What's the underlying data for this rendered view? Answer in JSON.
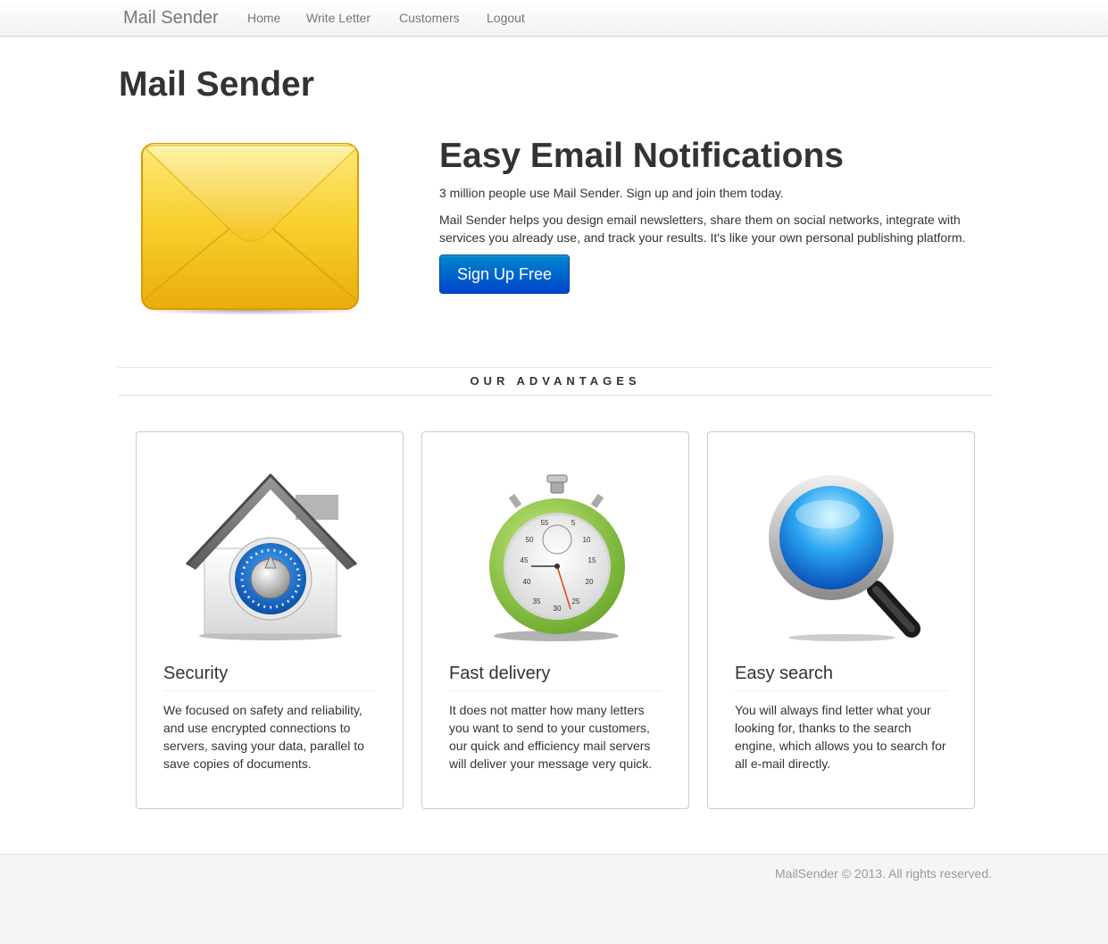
{
  "navbar": {
    "brand": "Mail Sender",
    "links": [
      {
        "label": "Home"
      },
      {
        "label": "Write Letter"
      },
      {
        "label": "Customers"
      },
      {
        "label": "Logout"
      }
    ]
  },
  "hero": {
    "page_title": "Mail Sender",
    "heading": "Easy Email Notifications",
    "lead": "3 million people use Mail Sender. Sign up and join them today.",
    "description": "Mail Sender helps you design email newsletters, share them on social networks, integrate with services you already use, and track your results. It's like your own personal publishing platform.",
    "signup_label": "Sign Up Free",
    "image_icon": "envelope-icon"
  },
  "advantages": {
    "title": "OUR ADVANTAGES",
    "cards": [
      {
        "icon": "house-lock-icon",
        "title": "Security",
        "text": "We focused on safety and reliability, and use encrypted connections to servers, saving your data, parallel to save copies of documents."
      },
      {
        "icon": "stopwatch-icon",
        "title": "Fast delivery",
        "text": "It does not matter how many letters you want to send to your customers, our quick and efficiency mail servers will deliver your message very quick."
      },
      {
        "icon": "magnifier-icon",
        "title": "Easy search",
        "text": "You will always find letter what your looking for, thanks to the search engine, which allows you to search for all e-mail directly."
      }
    ]
  },
  "stopwatch_numbers": [
    "55",
    "5",
    "50",
    "10",
    "45",
    "15",
    "40",
    "20",
    "35",
    "30",
    "25"
  ],
  "footer": {
    "text": "MailSender © 2013. All rights reserved."
  },
  "colors": {
    "brand_text": "#777777",
    "button_top": "#0088cc",
    "button_bottom": "#0044cc",
    "envelope_yellow": "#f5c518",
    "stopwatch_green": "#8cc63f",
    "lens_blue": "#1e90ff"
  }
}
